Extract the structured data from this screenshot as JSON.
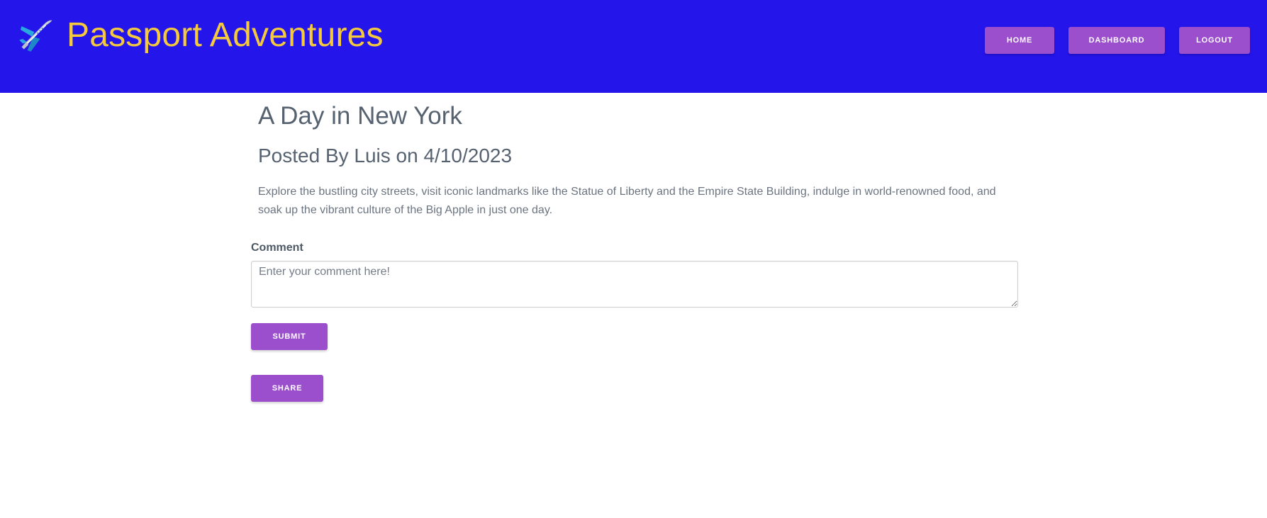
{
  "header": {
    "brand_title": "Passport Adventures",
    "brand_icon": "airplane-icon",
    "colors": {
      "background": "#2415ea",
      "brand_text": "#f5c93e",
      "button": "#9b4fcd"
    },
    "nav": {
      "home_label": "HOME",
      "dashboard_label": "DASHBOARD",
      "logout_label": "LOGOUT"
    }
  },
  "post": {
    "title": "A Day in New York",
    "meta": "Posted By Luis on 4/10/2023",
    "body": "Explore the bustling city streets, visit iconic landmarks like the Statue of Liberty and the Empire State Building, indulge in world-renowned food, and soak up the vibrant culture of the Big Apple in just one day."
  },
  "comment_form": {
    "label": "Comment",
    "placeholder": "Enter your comment here!",
    "value": "",
    "submit_label": "SUBMIT",
    "share_label": "SHARE"
  }
}
